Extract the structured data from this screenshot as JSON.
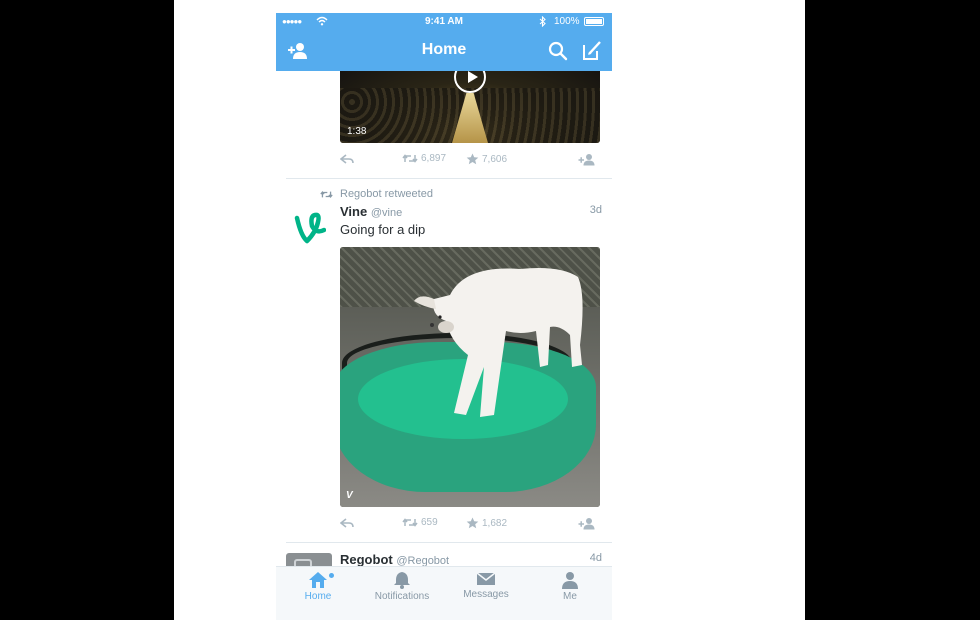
{
  "status_bar": {
    "signal": "●●●●●",
    "time": "9:41 AM",
    "battery": "100%"
  },
  "nav": {
    "title": "Home"
  },
  "tweets": [
    {
      "media_duration": "1:38",
      "retweets": "6,897",
      "favorites": "7,606"
    },
    {
      "retweeted_by": "Regobot retweeted",
      "name": "Vine",
      "handle": "@vine",
      "time": "3d",
      "text": "Going for a dip",
      "retweets": "659",
      "favorites": "1,682"
    },
    {
      "name": "Regobot",
      "handle": "@Regobot",
      "time": "4d"
    }
  ],
  "tabs": [
    {
      "label": "Home",
      "active": true
    },
    {
      "label": "Notifications",
      "active": false
    },
    {
      "label": "Messages",
      "active": false
    },
    {
      "label": "Me",
      "active": false
    }
  ],
  "colors": {
    "brand": "#55acee",
    "vine": "#00b488",
    "muted": "#8899a6"
  }
}
